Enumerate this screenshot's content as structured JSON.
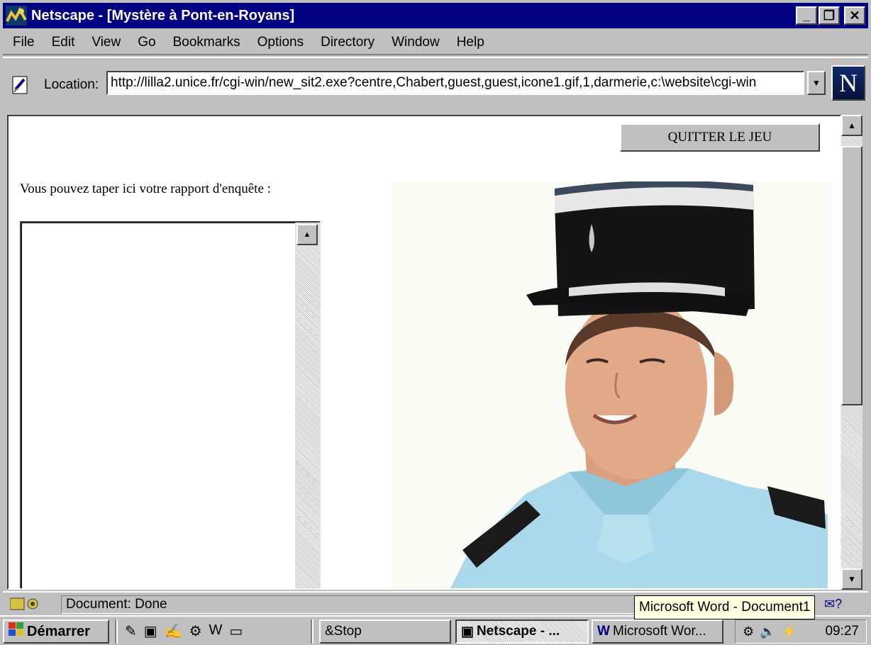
{
  "window": {
    "title": "Netscape - [Mystère à Pont-en-Royans]",
    "btn_min": "_",
    "btn_max": "❐",
    "btn_close": "✕"
  },
  "menu": {
    "items": [
      "File",
      "Edit",
      "View",
      "Go",
      "Bookmarks",
      "Options",
      "Directory",
      "Window",
      "Help"
    ]
  },
  "location": {
    "label": "Location:",
    "url": "http://lilla2.unice.fr/cgi-win/new_sit2.exe?centre,Chabert,guest,guest,icone1.gif,1,darmerie,c:\\website\\cgi-win",
    "logo": "N"
  },
  "page": {
    "quit_button": "QUITTER LE JEU",
    "prompt": "Vous pouvez taper ici votre rapport d'enquête :"
  },
  "status": {
    "text": "Document: Done",
    "tooltip": "Microsoft Word - Document1"
  },
  "taskbar": {
    "start_label": "Démarrer",
    "tasks": [
      "&Stop",
      "Netscape - ...",
      "Microsoft Wor..."
    ],
    "clock": "09:27"
  },
  "colors": {
    "titlebar": "#000080",
    "face": "#c0c0c0",
    "shirt": "#a9d9ea"
  },
  "icons": [
    "netscape-app-icon",
    "location-bookmark-icon",
    "netscape-logo-icon",
    "security-key-icon",
    "mail-icon",
    "start-windows-icon",
    "volume-icon"
  ]
}
